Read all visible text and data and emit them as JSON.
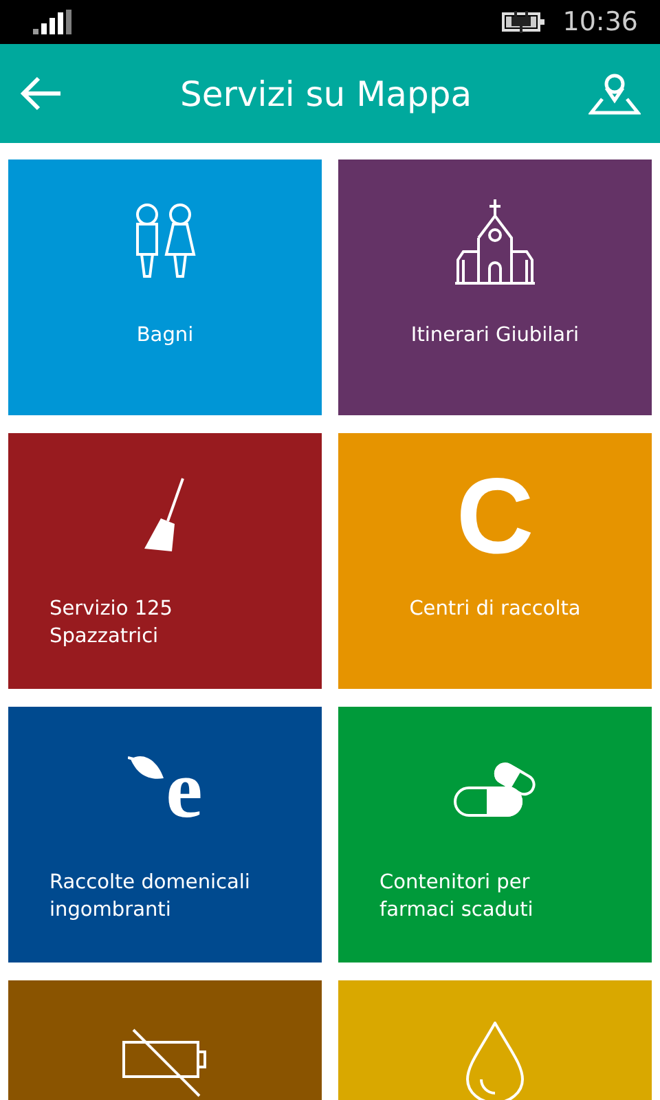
{
  "status_bar": {
    "time": "10:36"
  },
  "header": {
    "title": "Servizi su Mappa"
  },
  "tiles": [
    {
      "label": "Bagni",
      "color": "#0096d6",
      "kind": "people"
    },
    {
      "label": "Itinerari Giubilari",
      "color": "#643366",
      "kind": "church"
    },
    {
      "label": "Servizio 125 Spazzatrici",
      "color": "#981b1f",
      "kind": "broom"
    },
    {
      "label": "Centri di raccolta",
      "color": "#e69400",
      "kind": "glyph",
      "glyph": "C"
    },
    {
      "label": "Raccolte domenicali ingombranti",
      "color": "#004a8f",
      "kind": "leaf-glyph",
      "glyph": "e"
    },
    {
      "label": "Contenitori per farmaci scaduti",
      "color": "#009a3a",
      "kind": "pills"
    },
    {
      "color": "#8a5400",
      "kind": "battery"
    },
    {
      "color": "#d9a800",
      "kind": "drop"
    }
  ]
}
